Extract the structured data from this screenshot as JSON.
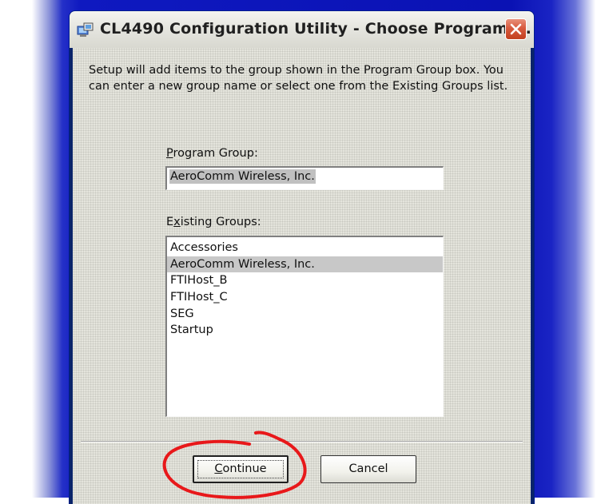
{
  "window": {
    "title": "CL4490 Configuration Utility - Choose Program ..."
  },
  "intro_text": "Setup will add items to the group shown in the Program Group box. You can enter a new group name or select one from the Existing Groups list.",
  "program_group": {
    "label_accel": "P",
    "label_rest": "rogram Group:",
    "value": "AeroComm Wireless, Inc."
  },
  "existing_groups": {
    "label_pre": "E",
    "label_accel": "x",
    "label_rest": "isting Groups:",
    "items": [
      "Accessories",
      "AeroComm Wireless, Inc.",
      "FTIHost_B",
      "FTIHost_C",
      "SEG",
      "Startup"
    ],
    "selected_index": 1
  },
  "buttons": {
    "continue_accel": "C",
    "continue_rest": "ontinue",
    "cancel": "Cancel"
  },
  "colors": {
    "desktop_blue": "#0f19c0",
    "annotation_red": "#e8181a"
  }
}
